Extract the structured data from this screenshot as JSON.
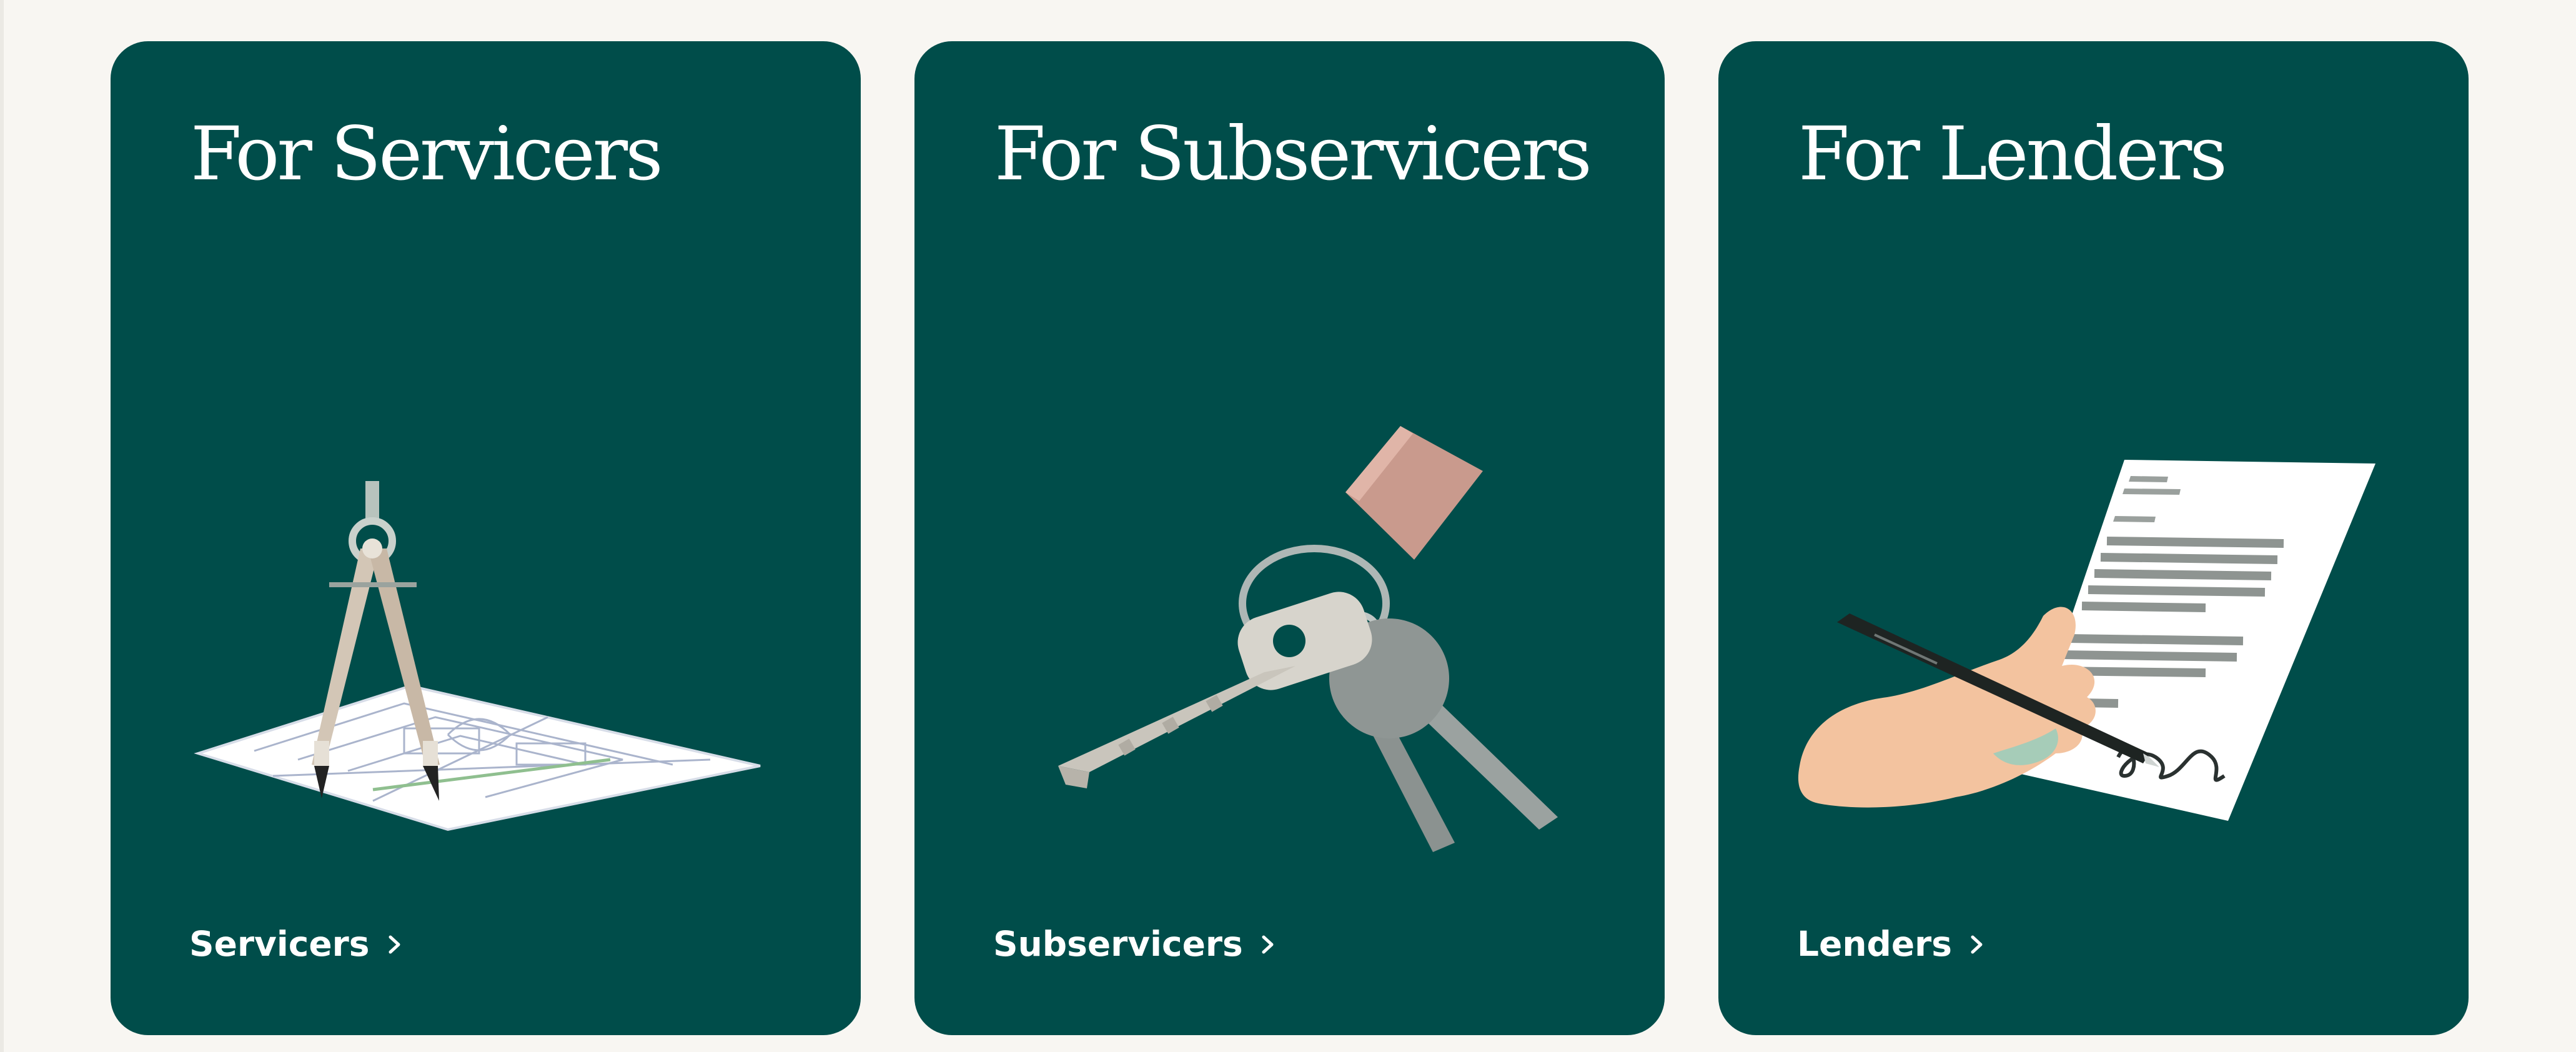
{
  "cards": [
    {
      "title": "For Servicers",
      "illustration": "compass-icon",
      "link_label": "Servicers",
      "link_icon": "chevron-right-icon"
    },
    {
      "title": "For Subservicers",
      "illustration": "keys-icon",
      "link_label": "Subservicers",
      "link_icon": "chevron-right-icon"
    },
    {
      "title": "For Lenders",
      "illustration": "signing-document-icon",
      "link_label": "Lenders",
      "link_icon": "chevron-right-icon"
    }
  ],
  "colors": {
    "page_background": "#f8f6f2",
    "card_background": "#004d4a",
    "card_text": "#ffffff",
    "key_fob": "#c99a8d",
    "skin": "#f3c39f"
  }
}
